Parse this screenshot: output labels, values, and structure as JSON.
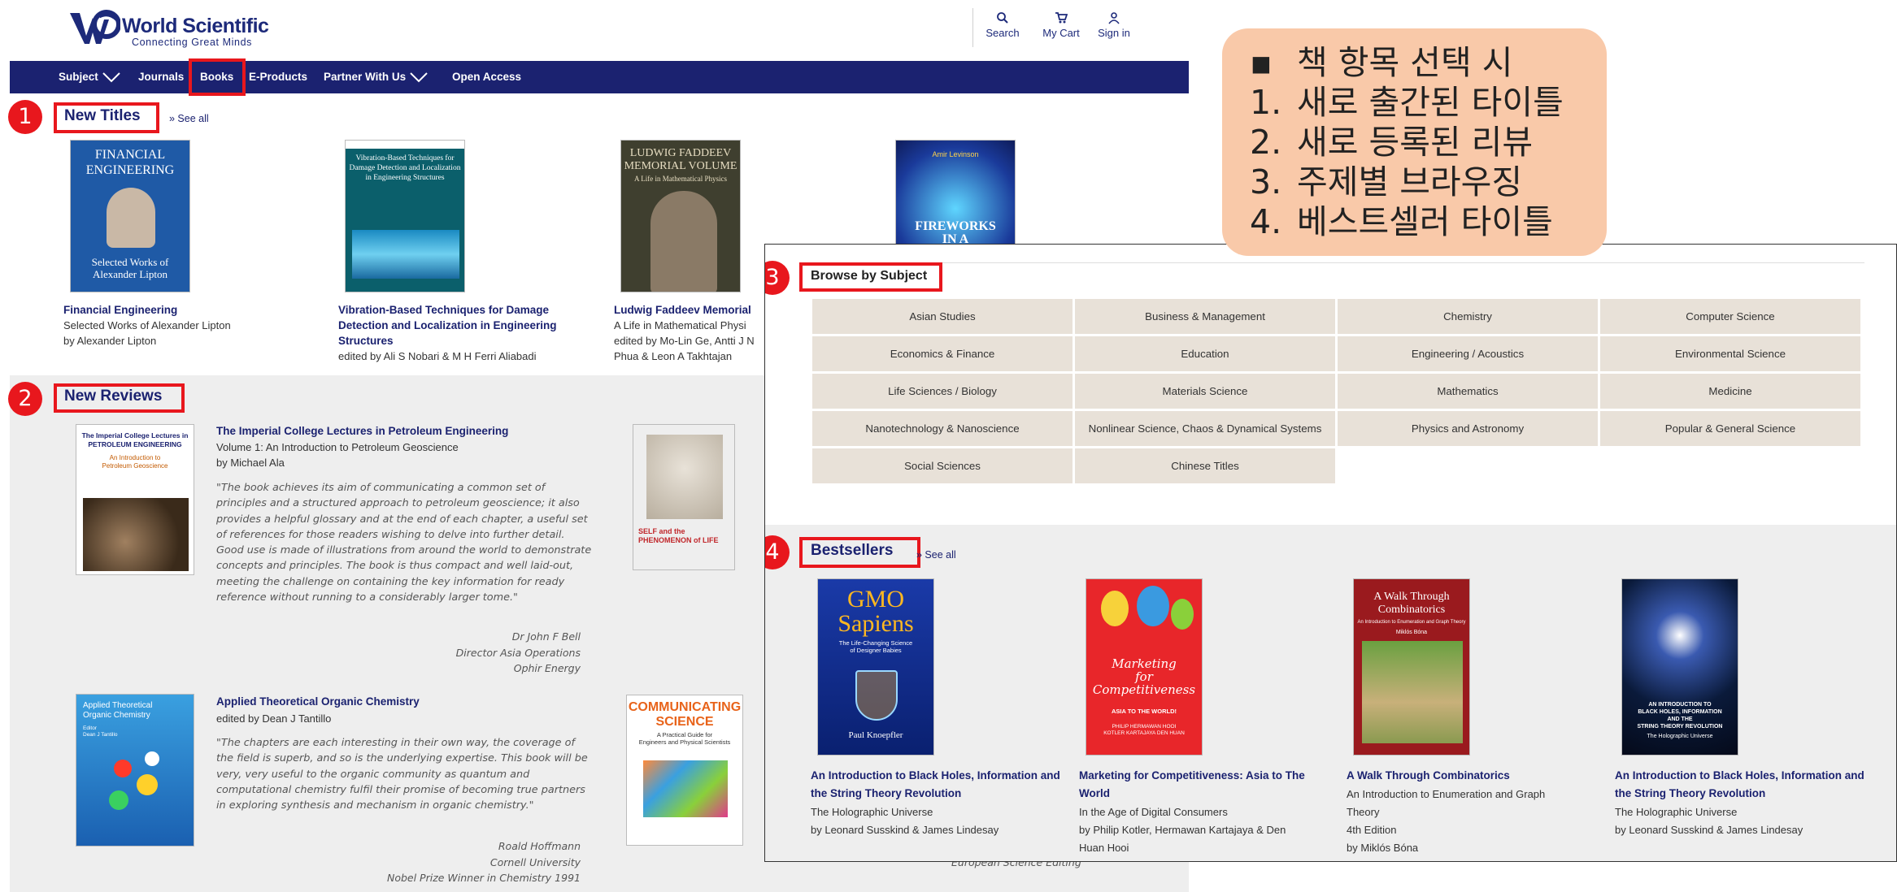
{
  "header": {
    "logo_name": "World Scientific",
    "logo_tagline": "Connecting Great Minds",
    "search_label": "Search",
    "cart_label": "My Cart",
    "signin_label": "Sign in"
  },
  "nav": {
    "subject": "Subject",
    "journals": "Journals",
    "books": "Books",
    "eproducts": "E-Products",
    "partner": "Partner With Us",
    "open_access": "Open Access"
  },
  "markers": [
    "1",
    "2",
    "3",
    "4"
  ],
  "new_titles": {
    "heading": "New Titles",
    "see_all": "» See all",
    "books": [
      {
        "cover_text": "FINANCIAL\nENGINEERING",
        "cover_sub": "Selected Works of\nAlexander Lipton",
        "title": "Financial Engineering",
        "subtitle": "Selected Works of Alexander Lipton",
        "author": "by Alexander Lipton"
      },
      {
        "cover_text": "Vibration-Based Techniques for\nDamage Detection and Localization\nin Engineering Structures",
        "title": "Vibration-Based Techniques for Damage Detection and Localization in Engineering Structures",
        "author": "edited by Ali S Nobari & M H Ferri Aliabadi"
      },
      {
        "cover_text": "LUDWIG FADDEEV\nMEMORIAL VOLUME",
        "cover_sub": "A Life in Mathematical Physics",
        "title": "Ludwig Faddeev Memorial",
        "subtitle": "A Life in Mathematical Physi",
        "author": "edited by Mo-Lin Ge, Antti J N",
        "author2": "Phua & Leon A Takhtajan"
      },
      {
        "cover_author": "Amir Levinson",
        "cover_text": "FIREWORKS\nIN A\nDARK\nUNIVERSE"
      }
    ]
  },
  "new_reviews": {
    "heading": "New Reviews",
    "items": [
      {
        "cover_text": "The Imperial College Lectures in\nPETROLEUM ENGINEERING",
        "cover_sub": "An Introduction to\nPetroleum Geoscience",
        "title": "The Imperial College Lectures in Petroleum Engineering",
        "subtitle": "Volume 1: An Introduction to Petroleum Geoscience",
        "author": "by Michael Ala",
        "quote": "\"The book achieves its aim of communicating a common set of principles and a structured approach to petroleum geoscience; it also provides a helpful glossary and at the end of each chapter, a useful set of references for those readers wishing to delve into further detail. Good use is made of illustrations from around the world to demonstrate concepts and principles. The book is thus compact and well laid-out, meeting the challenge on containing the key information for ready reference without running to a considerably larger tome.\"",
        "attribution": [
          "Dr John F Bell",
          "Director Asia Operations",
          "Ophir Energy"
        ]
      },
      {
        "cover_text": "Applied Theoretical\nOrganic Chemistry",
        "cover_sub": "Editor\nDean J Tantillo",
        "title": "Applied Theoretical Organic Chemistry",
        "author": "edited by Dean J Tantillo",
        "quote": "\"The chapters are each interesting in their own way, the coverage of the field is superb, and so is the underlying expertise. This book will be very, very useful to the organic community as quantum and computational chemistry fulfil their promise of becoming true partners in exploring synthesis and mechanism in organic chemistry.\"",
        "attribution": [
          "Roald Hoffmann",
          "Cornell University",
          "Nobel Prize Winner in Chemistry 1991"
        ]
      }
    ],
    "side_covers": [
      {
        "cover_text": "SELF and the\nPHENOMENON of LIFE"
      },
      {
        "cover_text": "COMMUNICATING\nSCIENCE",
        "cover_sub": "A Practical Guide for\nEngineers and Physical Scientists"
      }
    ],
    "cutoff_text": "European Science Editing"
  },
  "browse": {
    "heading": "Browse by Subject",
    "subjects": [
      "Asian Studies",
      "Business & Management",
      "Chemistry",
      "Computer Science",
      "Economics & Finance",
      "Education",
      "Engineering / Acoustics",
      "Environmental Science",
      "Life Sciences / Biology",
      "Materials Science",
      "Mathematics",
      "Medicine",
      "Nanotechnology & Nanoscience",
      "Nonlinear Science, Chaos & Dynamical Systems",
      "Physics and Astronomy",
      "Popular & General Science",
      "Social Sciences",
      "Chinese Titles"
    ]
  },
  "bestsellers": {
    "heading": "Bestsellers",
    "see_all": "» See all",
    "books": [
      {
        "cover_text": "GMO\nSapiens",
        "cover_sub": "The Life-Changing Science\nof Designer Babies",
        "cover_author": "Paul Knoepfler",
        "title": "An Introduction to Black Holes, Information and the String Theory Revolution",
        "lines": [
          "The Holographic Universe",
          "by Leonard Susskind & James Lindesay"
        ]
      },
      {
        "cover_text": "Marketing\nfor\nCompetitiveness",
        "cover_sub": "ASIA TO THE WORLD!",
        "cover_author": "PHILIP  HERMAWAN  HOOI\nKOTLER  KARTAJAYA  DEN HUAN",
        "title": "Marketing for Competitiveness: Asia to The World",
        "lines": [
          "In the Age of Digital Consumers",
          "by Philip Kotler, Hermawan Kartajaya & Den",
          "Huan Hooi"
        ]
      },
      {
        "cover_text": "A Walk Through\nCombinatorics",
        "cover_sub": "An Introduction to Enumeration and Graph Theory",
        "cover_author": "Miklós Bóna",
        "title": "A Walk Through Combinatorics",
        "lines": [
          "An Introduction to Enumeration and Graph",
          "Theory",
          "4th Edition",
          "by Miklós Bóna"
        ]
      },
      {
        "cover_text": "AN INTRODUCTION TO\nBLACK HOLES, INFORMATION\nAND THE\nSTRING THEORY REVOLUTION",
        "cover_sub": "The Holographic Universe",
        "title": "An Introduction to Black Holes, Information and the String Theory Revolution",
        "lines": [
          "The Holographic Universe",
          "by Leonard Susskind & James Lindesay"
        ]
      }
    ]
  },
  "callout": {
    "lines": [
      {
        "lead": "▪",
        "text": "책 항목 선택 시"
      },
      {
        "lead": "1.",
        "text": "새로 출간된 타이틀"
      },
      {
        "lead": "2.",
        "text": "새로 등록된 리뷰"
      },
      {
        "lead": "3.",
        "text": "주제별 브라우징"
      },
      {
        "lead": "4.",
        "text": "베스트셀러 타이틀"
      }
    ]
  },
  "colors": {
    "brand_navy": "#1b2270",
    "highlight_red": "#e8171d",
    "subject_cell": "#e8e1d8",
    "callout_bg": "#f9c9a9"
  }
}
